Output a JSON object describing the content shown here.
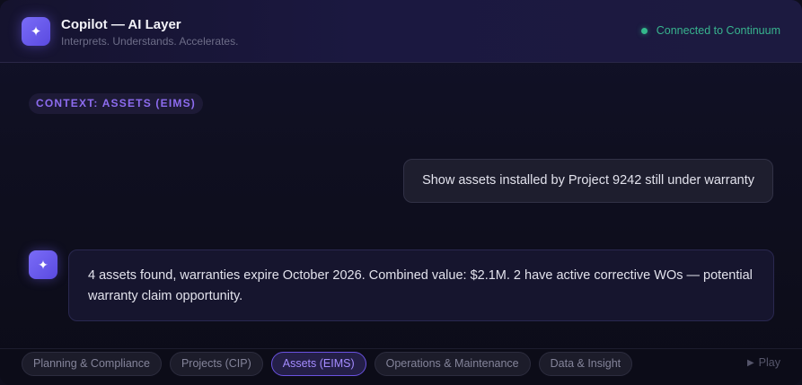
{
  "header": {
    "logo_glyph": "✦",
    "title": "Copilot — AI Layer",
    "subtitle": "Interprets. Understands. Accelerates.",
    "status": "Connected to Continuum"
  },
  "context": {
    "tag": "CONTEXT: ASSETS (EIMS)"
  },
  "conversation": {
    "user_message": "Show assets installed by Project 9242 still under warranty",
    "assistant_glyph": "✦",
    "assistant_message": "4 assets found, warranties expire October 2026. Combined value: $2.1M. 2 have active corrective WOs — potential warranty claim opportunity."
  },
  "footer": {
    "chips": [
      {
        "label": "Planning & Compliance",
        "active": false
      },
      {
        "label": "Projects (CIP)",
        "active": false
      },
      {
        "label": "Assets (EIMS)",
        "active": true
      },
      {
        "label": "Operations & Maintenance",
        "active": false
      },
      {
        "label": "Data & Insight",
        "active": false
      }
    ],
    "play_glyph": "▶",
    "play_label": "Play"
  },
  "colors": {
    "accent": "#7a6cf7",
    "status_green": "#34b98c",
    "context_tag": "#8d6cf0",
    "active_chip": "#a48cff"
  }
}
